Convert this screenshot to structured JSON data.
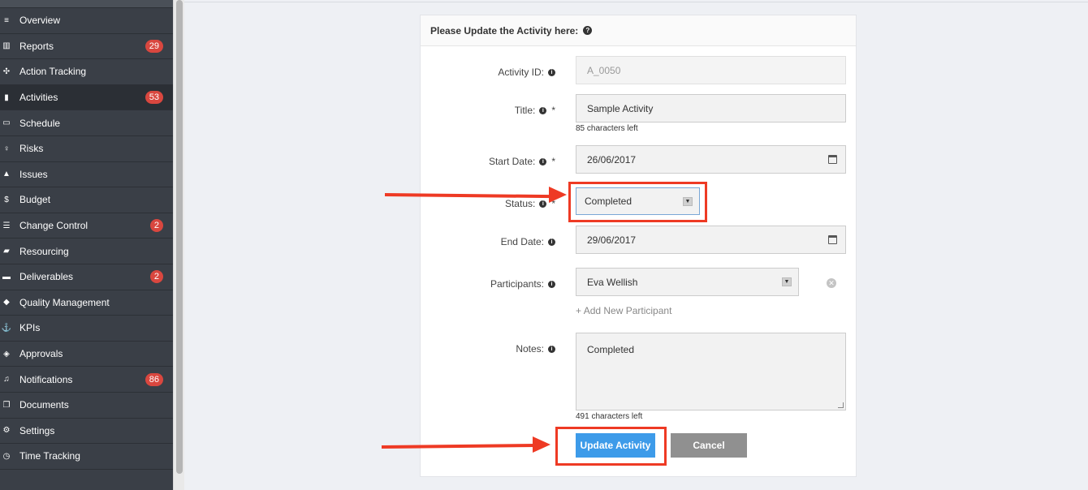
{
  "sidebar": {
    "items": [
      {
        "label": "Overview",
        "icon": "list-icon"
      },
      {
        "label": "Reports",
        "icon": "bar-chart-icon",
        "badge": "29"
      },
      {
        "label": "Action Tracking",
        "icon": "crosshair-icon"
      },
      {
        "label": "Activities",
        "icon": "bookmark-icon",
        "badge": "53",
        "active": true
      },
      {
        "label": "Schedule",
        "icon": "calendar-icon"
      },
      {
        "label": "Risks",
        "icon": "lightbulb-icon"
      },
      {
        "label": "Issues",
        "icon": "warning-icon"
      },
      {
        "label": "Budget",
        "icon": "dollar-icon"
      },
      {
        "label": "Change Control",
        "icon": "tasks-icon",
        "badge": "2"
      },
      {
        "label": "Resourcing",
        "icon": "folder-icon"
      },
      {
        "label": "Deliverables",
        "icon": "truck-icon",
        "badge": "2"
      },
      {
        "label": "Quality Management",
        "icon": "tag-icon"
      },
      {
        "label": "KPIs",
        "icon": "anchor-icon"
      },
      {
        "label": "Approvals",
        "icon": "ticket-icon"
      },
      {
        "label": "Notifications",
        "icon": "bell-icon",
        "badge": "86"
      },
      {
        "label": "Documents",
        "icon": "files-icon"
      },
      {
        "label": "Settings",
        "icon": "gears-icon"
      },
      {
        "label": "Time Tracking",
        "icon": "clock-icon"
      }
    ]
  },
  "form": {
    "header": "Please Update the Activity here:",
    "activity_id": {
      "label": "Activity ID:",
      "value": "A_0050"
    },
    "title": {
      "label": "Title:",
      "value": "Sample Activity",
      "hint": "85 characters left"
    },
    "start_date": {
      "label": "Start Date:",
      "value": "26/06/2017"
    },
    "status": {
      "label": "Status:",
      "value": "Completed"
    },
    "end_date": {
      "label": "End Date:",
      "value": "29/06/2017"
    },
    "participants": {
      "label": "Participants:",
      "value": "Eva Wellish",
      "add_label": "Add New Participant"
    },
    "notes": {
      "label": "Notes:",
      "value": "Completed",
      "hint": "491 characters left"
    },
    "required_mark": "*",
    "submit_label": "Update Activity",
    "cancel_label": "Cancel"
  },
  "colors": {
    "sidebar_bg": "#3a3f47",
    "badge": "#d9473f",
    "primary": "#3d9be9",
    "annotation": "#ee3a24"
  }
}
